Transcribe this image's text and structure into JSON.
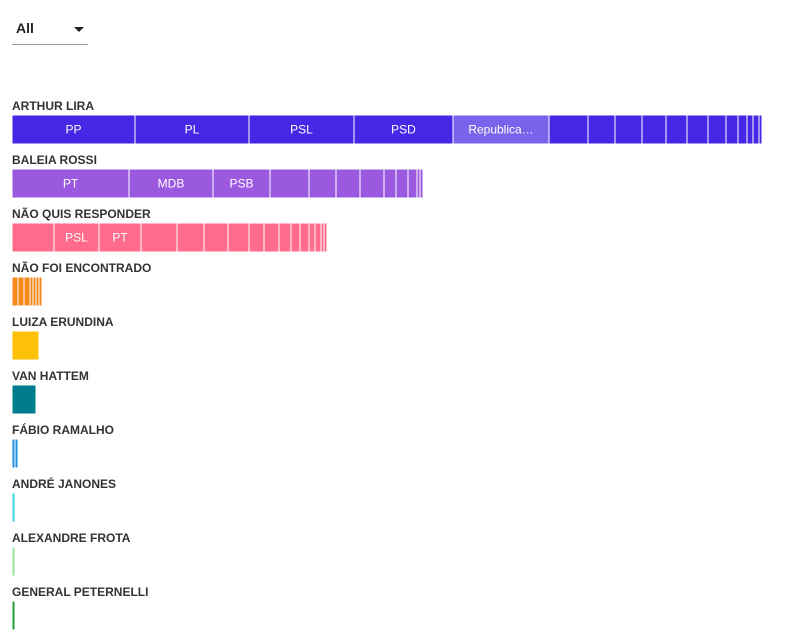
{
  "filter": {
    "selected": "All"
  },
  "chart_data": {
    "type": "bar",
    "stacked": true,
    "orientation": "horizontal",
    "unit": "votes",
    "bars": [
      {
        "name": "ARTHUR LIRA",
        "color": "#4527e6",
        "segments": [
          {
            "label": "PP",
            "value": 41
          },
          {
            "label": "PL",
            "value": 38
          },
          {
            "label": "PSL",
            "value": 35
          },
          {
            "label": "PSD",
            "value": 33
          },
          {
            "label": "Republica…",
            "value": 32,
            "color": "#7a63ea"
          },
          {
            "label": "",
            "value": 13
          },
          {
            "label": "",
            "value": 9
          },
          {
            "label": "",
            "value": 9
          },
          {
            "label": "",
            "value": 8
          },
          {
            "label": "",
            "value": 7
          },
          {
            "label": "",
            "value": 7
          },
          {
            "label": "",
            "value": 6
          },
          {
            "label": "",
            "value": 4
          },
          {
            "label": "",
            "value": 3
          },
          {
            "label": "",
            "value": 2
          },
          {
            "label": "",
            "value": 2
          },
          {
            "label": "",
            "value": 1
          }
        ]
      },
      {
        "name": "BALEIA ROSSI",
        "color": "#9b59e0",
        "segments": [
          {
            "label": "PT",
            "value": 39
          },
          {
            "label": "MDB",
            "value": 28
          },
          {
            "label": "PSB",
            "value": 19
          },
          {
            "label": "",
            "value": 13
          },
          {
            "label": "",
            "value": 9
          },
          {
            "label": "",
            "value": 8
          },
          {
            "label": "",
            "value": 8
          },
          {
            "label": "",
            "value": 4
          },
          {
            "label": "",
            "value": 4
          },
          {
            "label": "",
            "value": 3
          },
          {
            "label": "",
            "value": 1
          },
          {
            "label": "",
            "value": 1
          }
        ]
      },
      {
        "name": "NÃO QUIS RESPONDER",
        "color": "#ff6b8a",
        "segments": [
          {
            "label": "",
            "value": 14
          },
          {
            "label": "PSL",
            "value": 15
          },
          {
            "label": "PT",
            "value": 14
          },
          {
            "label": "",
            "value": 12
          },
          {
            "label": "",
            "value": 9
          },
          {
            "label": "",
            "value": 8
          },
          {
            "label": "",
            "value": 7
          },
          {
            "label": "",
            "value": 5
          },
          {
            "label": "",
            "value": 5
          },
          {
            "label": "",
            "value": 4
          },
          {
            "label": "",
            "value": 3
          },
          {
            "label": "",
            "value": 3
          },
          {
            "label": "",
            "value": 2
          },
          {
            "label": "",
            "value": 2
          },
          {
            "label": "",
            "value": 1
          },
          {
            "label": "",
            "value": 1
          }
        ]
      },
      {
        "name": "NÃO FOI ENCONTRADO",
        "color": "#f58a1a",
        "segments": [
          {
            "label": "",
            "value": 2
          },
          {
            "label": "",
            "value": 2
          },
          {
            "label": "",
            "value": 2
          },
          {
            "label": "",
            "value": 1
          },
          {
            "label": "",
            "value": 1
          },
          {
            "label": "",
            "value": 1
          },
          {
            "label": "",
            "value": 1
          }
        ]
      },
      {
        "name": "LUIZA ERUNDINA",
        "color": "#ffc107",
        "segments": [
          {
            "label": "",
            "value": 9
          }
        ]
      },
      {
        "name": "VAN HATTEM",
        "color": "#007d8c",
        "segments": [
          {
            "label": "",
            "value": 8
          }
        ]
      },
      {
        "name": "FÁBIO RAMALHO",
        "color": "#1e8fe6",
        "segments": [
          {
            "label": "",
            "value": 1
          },
          {
            "label": "",
            "value": 1
          }
        ]
      },
      {
        "name": "ANDRÉ JANONES",
        "color": "#3cd6e8",
        "segments": [
          {
            "label": "",
            "value": 1
          }
        ]
      },
      {
        "name": "ALEXANDRE FROTA",
        "color": "#9be09b",
        "segments": [
          {
            "label": "",
            "value": 1
          }
        ]
      },
      {
        "name": "GENERAL PETERNELLI",
        "color": "#1f9e3a",
        "segments": [
          {
            "label": "",
            "value": 1
          }
        ]
      }
    ]
  }
}
